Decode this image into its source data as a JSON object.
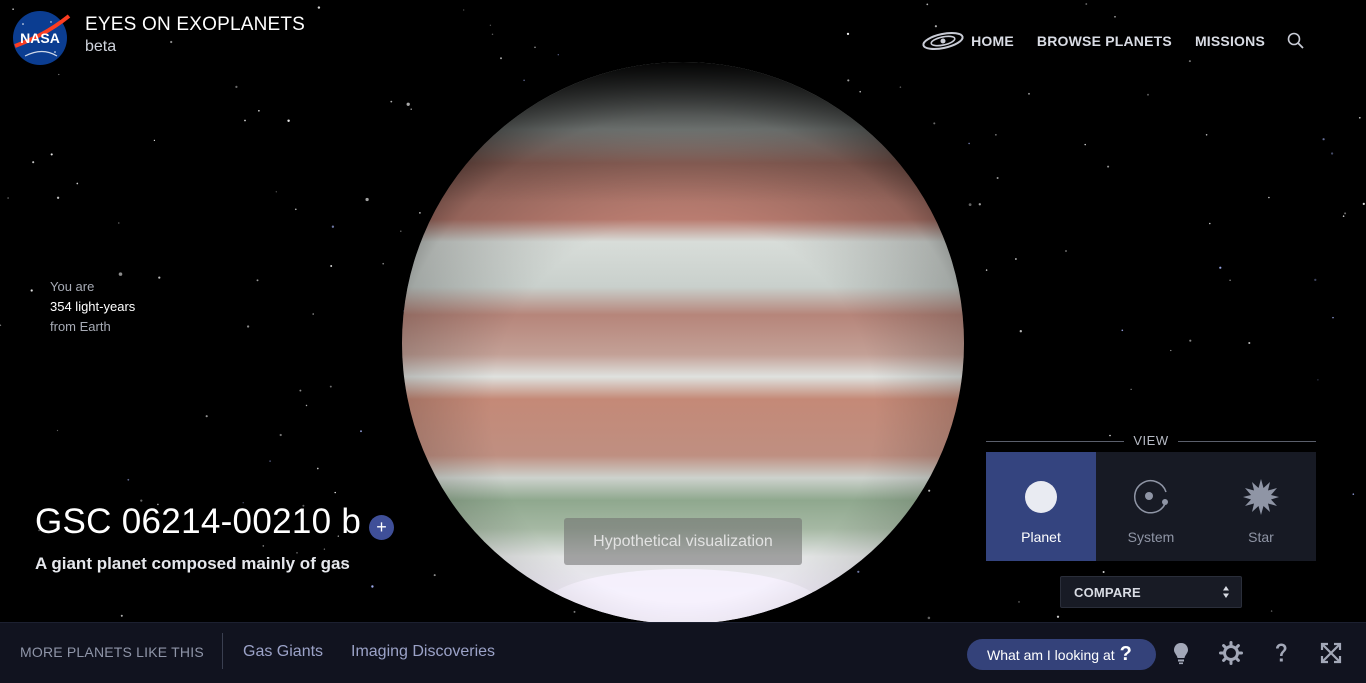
{
  "header": {
    "logo_text": "NASA",
    "title": "EYES ON EXOPLANETS",
    "subtitle": "beta",
    "nav": [
      {
        "label": "HOME",
        "icon": "galaxy-icon"
      },
      {
        "label": "BROWSE PLANETS"
      },
      {
        "label": "MISSIONS"
      }
    ],
    "search_icon": "search-icon"
  },
  "distance": {
    "line1": "You are",
    "line2": "354 light-years",
    "line3": "from Earth"
  },
  "planet": {
    "name": "GSC 06214-00210 b",
    "add_label": "+",
    "description": "A giant planet composed mainly of gas",
    "visualization_note": "Hypothetical visualization"
  },
  "view": {
    "header": "VIEW",
    "options": [
      {
        "label": "Planet",
        "icon": "planet-icon",
        "active": true
      },
      {
        "label": "System",
        "icon": "system-icon",
        "active": false
      },
      {
        "label": "Star",
        "icon": "star-icon",
        "active": false
      }
    ],
    "compare_label": "COMPARE"
  },
  "bottom_bar": {
    "more_label": "MORE PLANETS LIKE THIS",
    "categories": [
      "Gas Giants",
      "Imaging Discoveries"
    ],
    "what_label": "What am I looking at",
    "what_qmark": "?",
    "tools": [
      "lightbulb-icon",
      "gear-icon",
      "help-icon",
      "fullscreen-icon"
    ]
  },
  "colors": {
    "accent": "#34447f",
    "bar_background": "#11131f",
    "link": "#9ba2c7"
  }
}
